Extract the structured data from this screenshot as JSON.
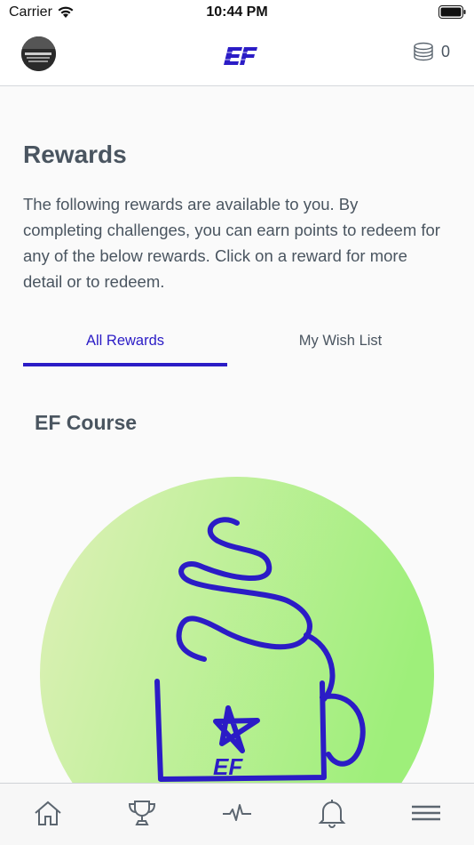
{
  "status_bar": {
    "carrier": "Carrier",
    "time": "10:44 PM"
  },
  "header": {
    "logo_text": "EF",
    "points": "0",
    "icons": {
      "avatar": "user-avatar",
      "logo": "ef-logo",
      "points": "coin-stack-icon"
    }
  },
  "rewards": {
    "title": "Rewards",
    "intro": "The following rewards are available to you. By completing challenges, you can earn points to redeem for any of the below rewards. Click on a reward for more detail or to redeem."
  },
  "tabs": [
    {
      "label": "All Rewards",
      "active": true
    },
    {
      "label": "My Wish List",
      "active": false
    }
  ],
  "reward_card": {
    "title": "EF Course",
    "image_text": "EF"
  },
  "bottom_nav": [
    {
      "icon": "home-icon"
    },
    {
      "icon": "trophy-icon"
    },
    {
      "icon": "activity-icon"
    },
    {
      "icon": "bell-icon"
    },
    {
      "icon": "menu-icon"
    }
  ],
  "colors": {
    "accent": "#2b1cc6",
    "text": "#4a5560",
    "reward_bg_start": "#dff0b8",
    "reward_bg_end": "#9eef7a"
  }
}
